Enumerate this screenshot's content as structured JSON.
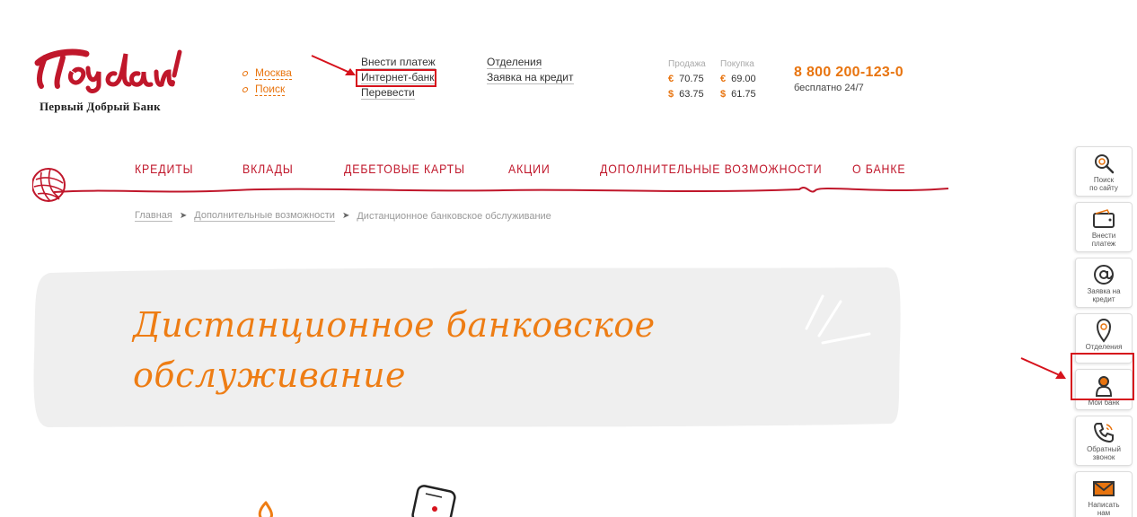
{
  "logo": {
    "text": "Пойдём!",
    "subtitle": "Первый Добрый Банк"
  },
  "city_links": [
    {
      "label": "Москва"
    },
    {
      "label": "Поиск"
    }
  ],
  "links_col1": [
    {
      "label": "Внести платеж"
    },
    {
      "label": "Интернет-банк"
    },
    {
      "label": "Перевести"
    }
  ],
  "links_col2": [
    {
      "label": "Отделения"
    },
    {
      "label": "Заявка на кредит"
    }
  ],
  "rates": {
    "sell_label": "Продажа",
    "buy_label": "Покупка",
    "rows": [
      {
        "symbol": "€",
        "sell": "70.75",
        "buy": "69.00"
      },
      {
        "symbol": "$",
        "sell": "63.75",
        "buy": "61.75"
      }
    ]
  },
  "phone": {
    "number": "8 800 200-123-0",
    "note": "бесплатно 24/7"
  },
  "nav": [
    {
      "label": "КРЕДИТЫ"
    },
    {
      "label": "ВКЛАДЫ"
    },
    {
      "label": "ДЕБЕТОВЫЕ КАРТЫ"
    },
    {
      "label": "АКЦИИ"
    },
    {
      "label": "ДОПОЛНИТЕЛЬНЫЕ ВОЗМОЖНОСТИ"
    },
    {
      "label": "О БАНКЕ"
    }
  ],
  "breadcrumb": {
    "home": "Главная",
    "section": "Дополнительные возможности",
    "current": "Дистанционное банковское обслуживание"
  },
  "hero": {
    "title_line1": "Дистанционное банковское",
    "title_line2": "обслуживание"
  },
  "sidebar": [
    {
      "label_1": "Поиск",
      "label_2": "по сайту",
      "icon": "search-icon"
    },
    {
      "label_1": "Внести",
      "label_2": "платеж",
      "icon": "wallet-icon"
    },
    {
      "label_1": "Заявка на",
      "label_2": "кредит",
      "icon": "at-icon"
    },
    {
      "label_1": "Отделения",
      "label_2": "",
      "icon": "map-pin-icon"
    },
    {
      "label_1": "Мой банк",
      "label_2": "",
      "icon": "user-icon"
    },
    {
      "label_1": "Обратный",
      "label_2": "звонок",
      "icon": "phone-call-icon"
    },
    {
      "label_1": "Написать",
      "label_2": "нам",
      "icon": "envelope-icon"
    }
  ],
  "colors": {
    "accent_orange": "#e8740f",
    "brand_red": "#c0172b",
    "highlight_red": "#d6121c",
    "hero_bg": "#efefef"
  }
}
